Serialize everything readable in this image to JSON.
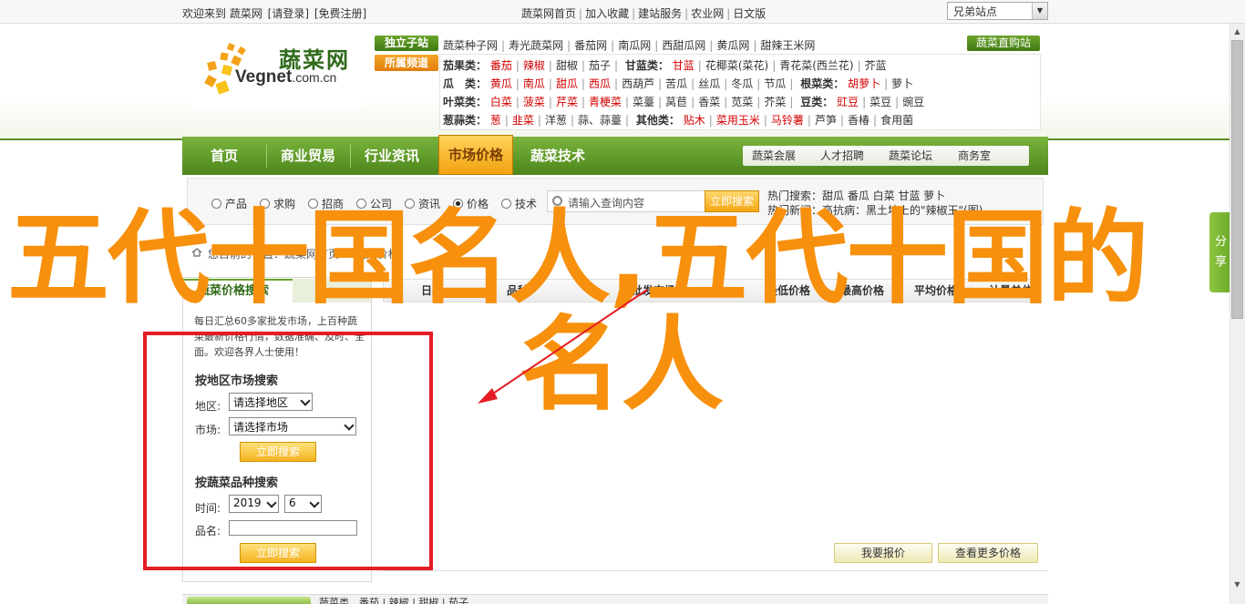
{
  "topbar": {
    "left_links": [
      "欢迎来到 蔬菜网",
      "[请登录]",
      "[免费注册]"
    ],
    "right_links": [
      "蔬菜网首页",
      "加入收藏",
      "建站服务",
      "农业网",
      "日文版"
    ],
    "site_nav_select": "兄弟站点"
  },
  "logo": {
    "cn": "蔬菜网",
    "en_main": "Vegnet",
    "en_domain": ".com.cn",
    "reg": "®"
  },
  "tags": {
    "solo": "独立子站",
    "featured": "所属频道",
    "portal": "蔬菜直购站"
  },
  "solo_links": [
    "蔬菜种子网",
    "寿光蔬菜网",
    "番茄网",
    "南瓜网",
    "西甜瓜网",
    "黄瓜网",
    "甜辣王米网"
  ],
  "categories": {
    "row1": {
      "k1": "茄果类：",
      "items1": [
        "番茄",
        "辣椒",
        "甜椒",
        "茄子"
      ],
      "k2": "甘蓝类：",
      "items2": [
        "甘蓝",
        "花椰菜(菜花)",
        "青花菜(西兰花)",
        "芥蓝"
      ]
    },
    "row2": {
      "k1": "瓜　类：",
      "items1": [
        "黄瓜",
        "南瓜",
        "甜瓜",
        "西瓜",
        "西葫芦",
        "苦瓜",
        "丝瓜",
        "冬瓜",
        "节瓜"
      ],
      "k2": "根菜类：",
      "items2": [
        "胡萝卜",
        "萝卜"
      ]
    },
    "row3": {
      "k1": "叶菜类：",
      "items1": [
        "白菜",
        "菠菜",
        "芹菜",
        "青梗菜",
        "菜薹",
        "莴苣",
        "香菜",
        "苋菜",
        "芥菜"
      ],
      "k2": "豆类：",
      "items2": [
        "豇豆",
        "菜豆",
        "豌豆"
      ]
    },
    "row4": {
      "k1": "葱蒜类：",
      "items1": [
        "葱",
        "韭菜",
        "洋葱",
        "蒜、蒜薹"
      ],
      "k2": "其他类：",
      "items2": [
        "贴木",
        "菜用玉米",
        "马铃薯",
        "芦笋",
        "香椿",
        "食用菌"
      ]
    }
  },
  "mainnav": {
    "items": [
      "首页",
      "商业贸易",
      "行业资讯",
      "市场价格",
      "蔬菜技术"
    ],
    "sub": [
      "蔬菜会展",
      "人才招聘",
      "蔬菜论坛",
      "商务室"
    ]
  },
  "search": {
    "options": [
      "产品",
      "求购",
      "招商",
      "公司",
      "资讯",
      "价格",
      "技术"
    ],
    "selected": "价格",
    "placeholder": "请输入查询内容",
    "button": "立即搜索",
    "hot_label": "热门搜索：",
    "hot_items": "甜瓜  番瓜  白菜  甘蓝  萝卜",
    "news_label": "热门新闻：",
    "news_item": "高抗病：黑土地上的\"辣椒王\"(图)"
  },
  "breadcrumb": "您目前的位置：蔬菜网首页 > 蔬菜价格",
  "left_panel": {
    "tab": "蔬菜价格搜索",
    "desc": "每日汇总60多家批发市场，上百种蔬菜最新价格行情，数据准确、及时、全面。欢迎各界人士使用！",
    "region_heading": "按地区市场搜索",
    "region_label": "地区:",
    "region_value": "请选择地区",
    "market_label": "市场:",
    "market_value": "请选择市场",
    "search_btn": "立即搜索",
    "variety_heading": "按蔬菜品种搜索",
    "time_label": "时间:",
    "year_value": "2019",
    "month_value": "6",
    "name_label": "品名:",
    "search_btn2": "立即搜索"
  },
  "table": {
    "headers": [
      "日期",
      "品种",
      "批发市场",
      "最低价格",
      "最高价格",
      "平均价格",
      "计量单位"
    ],
    "btn_report": "我要报价",
    "btn_more": "查看更多价格"
  },
  "bottom": {
    "tab": "",
    "links": "蔬菜类　番茄 | 辣椒 | 甜椒 | 茄子"
  },
  "share": "分享",
  "overlay": {
    "line1": "五代十国名人,五代十国的",
    "line2": "名人"
  },
  "colors": {
    "nav_green": "#5a9426",
    "accent_orange": "#f7900c",
    "red_box": "#e51c23"
  }
}
